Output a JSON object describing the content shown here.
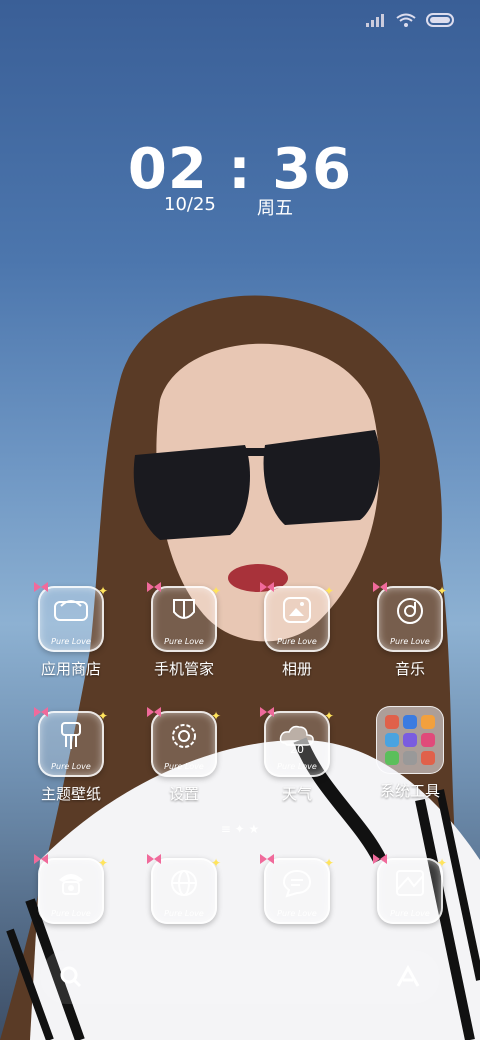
{
  "status_bar": {
    "signal": "signal-icon",
    "wifi": "wifi-icon",
    "battery": "battery-icon"
  },
  "clock": {
    "time": "02 : 36",
    "date": "10/25",
    "weekday": "周五"
  },
  "badge_text": "Pure Love",
  "apps_row1": [
    {
      "label": "应用商店",
      "icon": "store-icon"
    },
    {
      "label": "手机管家",
      "icon": "shield-icon"
    },
    {
      "label": "相册",
      "icon": "gallery-icon"
    },
    {
      "label": "音乐",
      "icon": "music-icon"
    }
  ],
  "apps_row2": [
    {
      "label": "主题壁纸",
      "icon": "brush-icon"
    },
    {
      "label": "设置",
      "icon": "settings-icon"
    },
    {
      "label": "天气",
      "icon": "weather-icon",
      "temp": "20"
    },
    {
      "label": "系统工具",
      "icon": "folder-icon"
    }
  ],
  "dock_apps": [
    {
      "icon": "phone-icon"
    },
    {
      "icon": "browser-icon"
    },
    {
      "icon": "message-icon"
    },
    {
      "icon": "camera-icon"
    }
  ],
  "dock_bar": {
    "left": "search-icon",
    "right": "assistant-icon"
  },
  "colors": {
    "accent_star": "#ffe45c",
    "bow": "#f06a9b"
  }
}
